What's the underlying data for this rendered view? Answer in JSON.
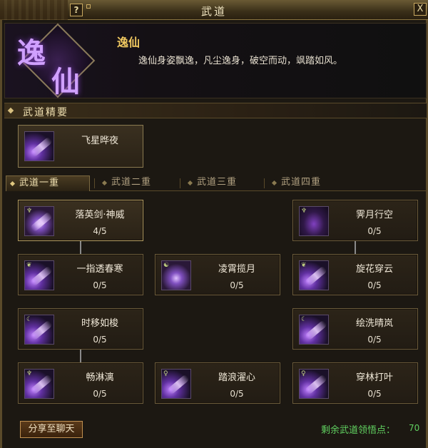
{
  "window": {
    "title": "武道",
    "help_label": "?",
    "close_label": "X"
  },
  "header": {
    "emblem_chars": [
      "逸",
      "仙"
    ],
    "school_name": "逸仙",
    "school_desc": "逸仙身姿飘逸，凡尘逸身，破空而动，飒踏如风。"
  },
  "section": {
    "title": "武道精要"
  },
  "featured": {
    "name": "飞星晔夜",
    "icon": "sword-slash-icon"
  },
  "tabs": [
    {
      "label": "武道一重",
      "active": true
    },
    {
      "label": "武道二重",
      "active": false
    },
    {
      "label": "武道三重",
      "active": false
    },
    {
      "label": "武道四重",
      "active": false
    }
  ],
  "skills": [
    {
      "name": "落英剑·神威",
      "level": "4/5",
      "icon": "sword-slash-icon"
    },
    {
      "name": "霁月行空",
      "level": "0/5",
      "icon": "shadow-figure-icon"
    },
    {
      "name": "一指透春寒",
      "level": "0/5",
      "icon": "sword-slash-icon"
    },
    {
      "name": "凌霄揽月",
      "level": "0/5",
      "icon": "swirl-icon"
    },
    {
      "name": "旋花穿云",
      "level": "0/5",
      "icon": "sword-slash-icon"
    },
    {
      "name": "时移如梭",
      "level": "0/5",
      "icon": "sword-slash-icon"
    },
    {
      "name": "绘洗晴岚",
      "level": "0/5",
      "icon": "sword-slash-icon"
    },
    {
      "name": "畅淋漓",
      "level": "0/5",
      "icon": "sword-slash-icon"
    },
    {
      "name": "踏浪濯心",
      "level": "0/5",
      "icon": "sword-slash-icon"
    },
    {
      "name": "穿林打叶",
      "level": "0/5",
      "icon": "sword-slash-icon"
    }
  ],
  "footer": {
    "share_label": "分享至聊天",
    "points_label": "剩余武道领悟点：",
    "points_value": "70"
  }
}
